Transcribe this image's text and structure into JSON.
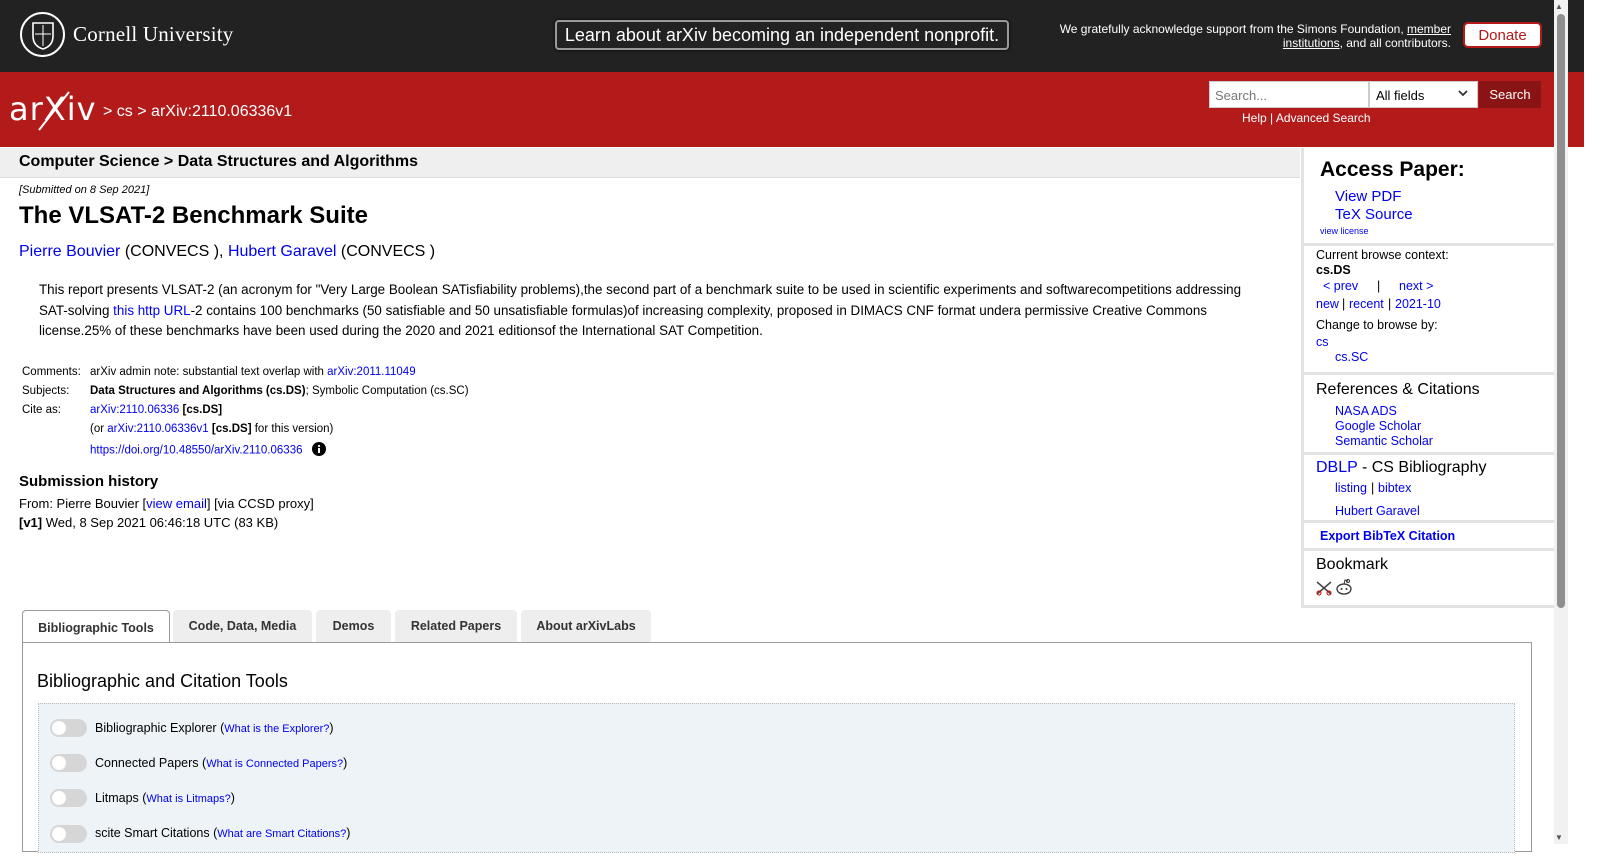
{
  "topbar": {
    "university": "Cornell University",
    "nonprofit_banner": "Learn about arXiv becoming an independent nonprofit.",
    "ack_prefix": "We gratefully acknowledge support from the Simons Foundation, ",
    "ack_member": "member institutions",
    "ack_suffix": ", and all contributors.",
    "donate": "Donate"
  },
  "header": {
    "logo": "arXiv",
    "crumb_sep": ">",
    "crumb_cs": "cs",
    "crumb_id": "arXiv:2110.06336v1",
    "search_placeholder": "Search...",
    "search_field": "All fields",
    "search_button": "Search",
    "help": "Help",
    "advanced": "Advanced Search",
    "link_sep": " | "
  },
  "paper": {
    "subject_header": "Computer Science > Data Structures and Algorithms",
    "submitted": "[Submitted on 8 Sep 2021]",
    "title": "The VLSAT-2 Benchmark Suite",
    "authors": [
      {
        "name": "Pierre Bouvier",
        "affil": " (CONVECS )"
      },
      {
        "name": "Hubert Garavel",
        "affil": " (CONVECS )"
      }
    ],
    "author_sep": ", ",
    "abstract_1": "This report presents VLSAT-2 (an acronym for \"Very Large Boolean SATisfiability problems),the second part of a benchmark suite to be used in scientific experiments and softwarecompetitions addressing SAT-solving ",
    "abstract_link": "this http URL",
    "abstract_2": "-2 contains 100 benchmarks (50 satisfiable and 50 unsatisfiable formulas)of increasing complexity, proposed in DIMACS CNF format undera permissive Creative Commons license.25% of these benchmarks have been used during the 2020 and 2021 editionsof the International SAT Competition.",
    "comments_label": "Comments:",
    "comments_text": "arXiv admin note: substantial text overlap with ",
    "comments_link": "arXiv:2011.11049",
    "subjects_label": "Subjects:",
    "subjects_primary": "Data Structures and Algorithms (cs.DS)",
    "subjects_rest": "; Symbolic Computation (cs.SC)",
    "cite_label": "Cite as:",
    "cite_id": "arXiv:2110.06336",
    "cite_cat": " [cs.DS]",
    "cite_or_pre": "(or ",
    "cite_or_id": "arXiv:2110.06336v1",
    "cite_or_cat": " [cs.DS]",
    "cite_or_post": " for this version)",
    "doi": "https://doi.org/10.48550/arXiv.2110.06336",
    "history_title": "Submission history",
    "history_from_pre": "From: Pierre Bouvier [",
    "history_view_email": "view email",
    "history_from_post": "] [via CCSD proxy]",
    "history_v1_label": "[v1]",
    "history_v1_text": " Wed, 8 Sep 2021 06:46:18 UTC (83 KB)"
  },
  "sidebar": {
    "access_title": "Access Paper:",
    "view_pdf": "View PDF",
    "tex_source": "TeX Source",
    "view_license": "view license",
    "browse_context_label": "Current browse context:",
    "browse_context": "cs.DS",
    "prev": "< prev",
    "pipe": "|",
    "next": "next >",
    "new": "new",
    "recent": "recent",
    "month": "2021-10",
    "change_label": "Change to browse by:",
    "browse_cs": "cs",
    "browse_cssc": "cs.SC",
    "refs_title": "References & Citations",
    "nasa": "NASA ADS",
    "google": "Google Scholar",
    "semantic": "Semantic Scholar",
    "dblp": "DBLP",
    "dblp_rest": " - CS Bibliography",
    "listing": "listing",
    "bibtex": "bibtex",
    "dblp_author": "Hubert Garavel",
    "export": "Export BibTeX Citation",
    "bookmark": "Bookmark"
  },
  "tabs": [
    {
      "label": "Bibliographic Tools"
    },
    {
      "label": "Code, Data, Media"
    },
    {
      "label": "Demos"
    },
    {
      "label": "Related Papers"
    },
    {
      "label": "About arXivLabs"
    }
  ],
  "tools": {
    "title": "Bibliographic and Citation Tools",
    "items": [
      {
        "name": "Bibliographic Explorer",
        "help": "What is the Explorer?"
      },
      {
        "name": "Connected Papers",
        "help": "What is Connected Papers?"
      },
      {
        "name": "Litmaps",
        "help": "What is Litmaps?"
      },
      {
        "name": "scite Smart Citations",
        "help": "What are Smart Citations?"
      }
    ]
  }
}
